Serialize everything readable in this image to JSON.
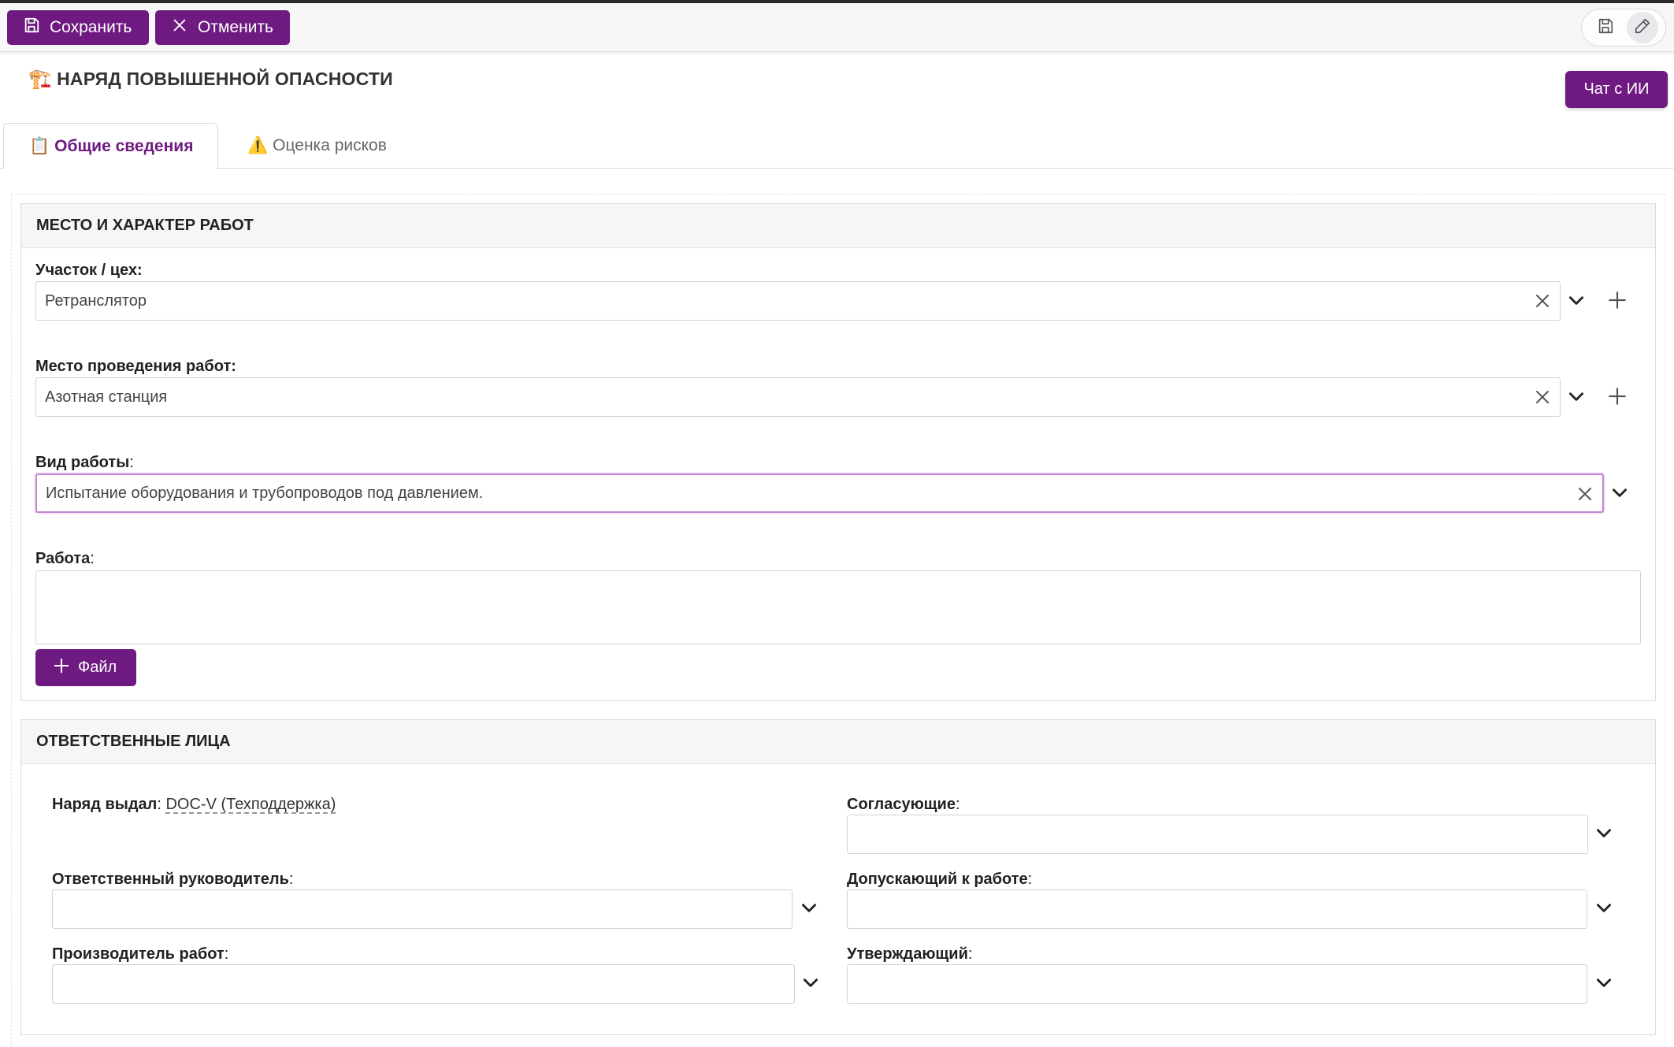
{
  "toolbar": {
    "save_label": "Сохранить",
    "cancel_label": "Отменить"
  },
  "page": {
    "title": "НАРЯД ПОВЫШЕННОЙ ОПАСНОСТИ",
    "title_emoji": "🏗️",
    "ai_chat_label": "Чат с ИИ"
  },
  "tabs": [
    {
      "label": "Общие сведения",
      "emoji": "📋",
      "active": true
    },
    {
      "label": "Оценка рисков",
      "emoji": "⚠️",
      "active": false
    }
  ],
  "section_work": {
    "heading": "МЕСТО И ХАРАКТЕР РАБОТ",
    "site_label": "Участок / цех:",
    "site_value": "Ретранслятор",
    "place_label": "Место проведения работ:",
    "place_value": "Азотная станция",
    "worktype_label": "Вид работы",
    "worktype_value": "Испытание оборудования и трубопроводов под давлением.",
    "work_label": "Работа",
    "work_value": "",
    "file_button_label": "Файл"
  },
  "section_people": {
    "heading": "ОТВЕТСТВЕННЫЕ ЛИЦА",
    "issued_label": "Наряд выдал",
    "issued_value": "DOC-V (Техподдержка)",
    "approvers_label": "Согласующие",
    "responsible_manager_label": "Ответственный руководитель",
    "admitting_label": "Допускающий к работе",
    "work_producer_label": "Производитель работ",
    "confirming_label": "Утверждающий"
  },
  "colors": {
    "accent": "#6e1a80",
    "focus_border": "#c684d4"
  }
}
